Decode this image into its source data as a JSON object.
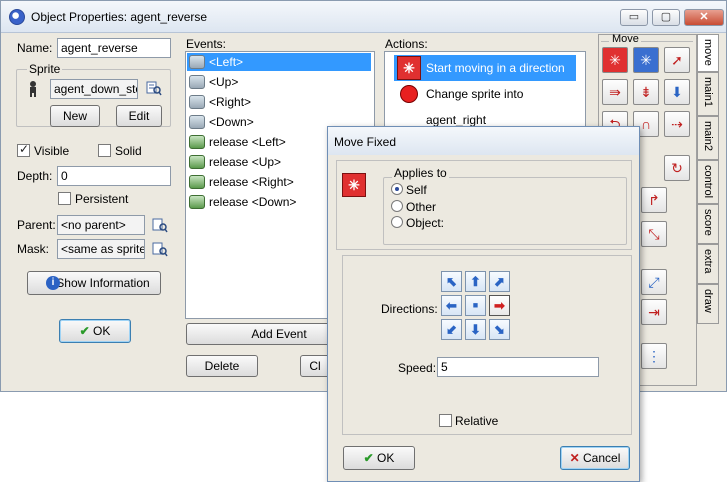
{
  "window": {
    "title": "Object Properties: agent_reverse"
  },
  "titlebar_buttons": {
    "minimize": "▭",
    "maximize": "▢",
    "close": "✕"
  },
  "left": {
    "name_label": "Name:",
    "name_value": "agent_reverse",
    "sprite_group": "Sprite",
    "sprite_value": "agent_down_stop",
    "new_btn": "New",
    "edit_btn": "Edit",
    "visible_label": "Visible",
    "solid_label": "Solid",
    "depth_label": "Depth:",
    "depth_value": "0",
    "persistent_label": "Persistent",
    "parent_label": "Parent:",
    "parent_value": "<no parent>",
    "mask_label": "Mask:",
    "mask_value": "<same as sprite>",
    "show_info_btn": "Show Information",
    "ok_btn": "OK"
  },
  "events": {
    "label": "Events:",
    "items": [
      "<Left>",
      "<Up>",
      "<Right>",
      "<Down>",
      "release <Left>",
      "release <Up>",
      "release <Right>",
      "release <Down>"
    ],
    "add_event_btn": "Add Event",
    "delete_btn": "Delete",
    "change_btn": "Cl"
  },
  "actions": {
    "label": "Actions:",
    "items": [
      "Start moving in a direction",
      "Change sprite into agent_right"
    ]
  },
  "palette": {
    "group_label": "Move",
    "tabs": [
      "move",
      "main1",
      "main2",
      "control",
      "score",
      "extra",
      "draw"
    ]
  },
  "dialog": {
    "title": "Move Fixed",
    "applies_to_label": "Applies to",
    "self_label": "Self",
    "other_label": "Other",
    "object_label": "Object:",
    "directions_label": "Directions:",
    "speed_label": "Speed:",
    "speed_value": "5",
    "relative_label": "Relative",
    "ok_btn": "OK",
    "cancel_btn": "Cancel"
  },
  "colors": {
    "selection": "#3399ff",
    "icon_red": "#e03030",
    "arrow_blue": "#2a64c4"
  }
}
